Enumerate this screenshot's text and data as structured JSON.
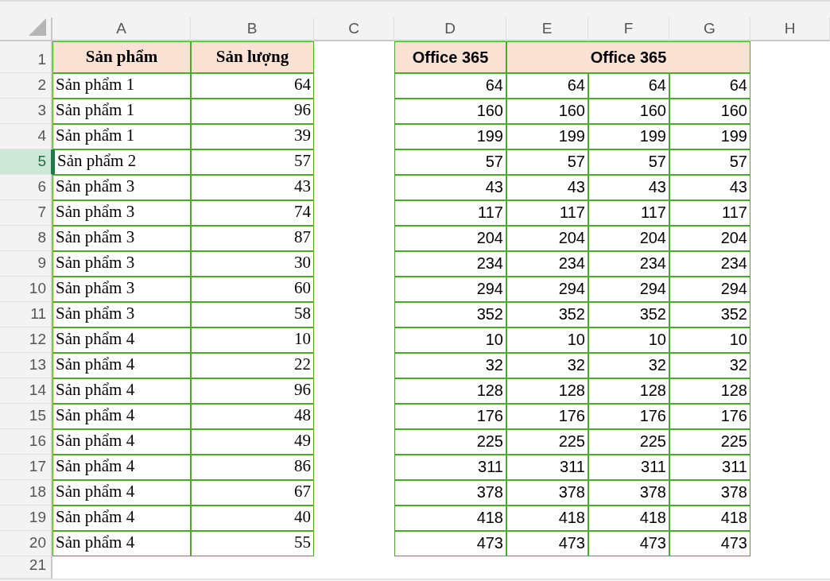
{
  "column_headers": [
    "A",
    "B",
    "C",
    "D",
    "E",
    "F",
    "G",
    "H"
  ],
  "header_row": {
    "number": "1",
    "selected": false,
    "product": "Sản phẩm",
    "output": "Sản lượng",
    "col_d": "Office 365",
    "merged_e_g": "Office 365"
  },
  "rows": [
    {
      "number": "2",
      "selected": false,
      "product": "Sản phẩm 1",
      "output": "64",
      "values": [
        "64",
        "64",
        "64",
        "64"
      ]
    },
    {
      "number": "3",
      "selected": false,
      "product": "Sản phẩm 1",
      "output": "96",
      "values": [
        "160",
        "160",
        "160",
        "160"
      ]
    },
    {
      "number": "4",
      "selected": false,
      "product": "Sản phẩm 1",
      "output": "39",
      "values": [
        "199",
        "199",
        "199",
        "199"
      ]
    },
    {
      "number": "5",
      "selected": true,
      "product": "Sản phẩm 2",
      "output": "57",
      "values": [
        "57",
        "57",
        "57",
        "57"
      ]
    },
    {
      "number": "6",
      "selected": false,
      "product": "Sản phẩm 3",
      "output": "43",
      "values": [
        "43",
        "43",
        "43",
        "43"
      ]
    },
    {
      "number": "7",
      "selected": false,
      "product": "Sản phẩm 3",
      "output": "74",
      "values": [
        "117",
        "117",
        "117",
        "117"
      ]
    },
    {
      "number": "8",
      "selected": false,
      "product": "Sản phẩm 3",
      "output": "87",
      "values": [
        "204",
        "204",
        "204",
        "204"
      ]
    },
    {
      "number": "9",
      "selected": false,
      "product": "Sản phẩm 3",
      "output": "30",
      "values": [
        "234",
        "234",
        "234",
        "234"
      ]
    },
    {
      "number": "10",
      "selected": false,
      "product": "Sản phẩm 3",
      "output": "60",
      "values": [
        "294",
        "294",
        "294",
        "294"
      ]
    },
    {
      "number": "11",
      "selected": false,
      "product": "Sản phẩm 3",
      "output": "58",
      "values": [
        "352",
        "352",
        "352",
        "352"
      ]
    },
    {
      "number": "12",
      "selected": false,
      "product": "Sản phẩm 4",
      "output": "10",
      "values": [
        "10",
        "10",
        "10",
        "10"
      ]
    },
    {
      "number": "13",
      "selected": false,
      "product": "Sản phẩm 4",
      "output": "22",
      "values": [
        "32",
        "32",
        "32",
        "32"
      ]
    },
    {
      "number": "14",
      "selected": false,
      "product": "Sản phẩm 4",
      "output": "96",
      "values": [
        "128",
        "128",
        "128",
        "128"
      ]
    },
    {
      "number": "15",
      "selected": false,
      "product": "Sản phẩm 4",
      "output": "48",
      "values": [
        "176",
        "176",
        "176",
        "176"
      ]
    },
    {
      "number": "16",
      "selected": false,
      "product": "Sản phẩm 4",
      "output": "49",
      "values": [
        "225",
        "225",
        "225",
        "225"
      ]
    },
    {
      "number": "17",
      "selected": false,
      "product": "Sản phẩm 4",
      "output": "86",
      "values": [
        "311",
        "311",
        "311",
        "311"
      ]
    },
    {
      "number": "18",
      "selected": false,
      "product": "Sản phẩm 4",
      "output": "67",
      "values": [
        "378",
        "378",
        "378",
        "378"
      ]
    },
    {
      "number": "19",
      "selected": false,
      "product": "Sản phẩm 4",
      "output": "40",
      "values": [
        "418",
        "418",
        "418",
        "418"
      ]
    },
    {
      "number": "20",
      "selected": false,
      "product": "Sản phẩm 4",
      "output": "55",
      "values": [
        "473",
        "473",
        "473",
        "473"
      ]
    }
  ],
  "empty_rows": [
    {
      "number": "21",
      "selected": false
    }
  ]
}
